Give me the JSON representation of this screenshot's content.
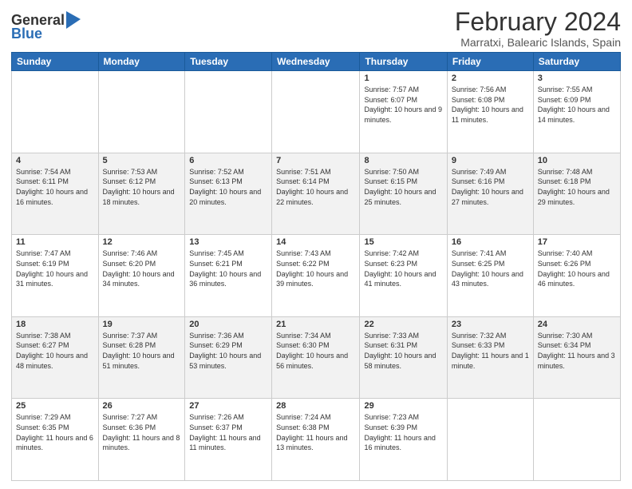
{
  "header": {
    "logo_general": "General",
    "logo_blue": "Blue",
    "title": "February 2024",
    "subtitle": "Marratxi, Balearic Islands, Spain"
  },
  "weekdays": [
    "Sunday",
    "Monday",
    "Tuesday",
    "Wednesday",
    "Thursday",
    "Friday",
    "Saturday"
  ],
  "weeks": [
    [
      {
        "day": "",
        "info": ""
      },
      {
        "day": "",
        "info": ""
      },
      {
        "day": "",
        "info": ""
      },
      {
        "day": "",
        "info": ""
      },
      {
        "day": "1",
        "info": "Sunrise: 7:57 AM\nSunset: 6:07 PM\nDaylight: 10 hours and 9 minutes."
      },
      {
        "day": "2",
        "info": "Sunrise: 7:56 AM\nSunset: 6:08 PM\nDaylight: 10 hours and 11 minutes."
      },
      {
        "day": "3",
        "info": "Sunrise: 7:55 AM\nSunset: 6:09 PM\nDaylight: 10 hours and 14 minutes."
      }
    ],
    [
      {
        "day": "4",
        "info": "Sunrise: 7:54 AM\nSunset: 6:11 PM\nDaylight: 10 hours and 16 minutes."
      },
      {
        "day": "5",
        "info": "Sunrise: 7:53 AM\nSunset: 6:12 PM\nDaylight: 10 hours and 18 minutes."
      },
      {
        "day": "6",
        "info": "Sunrise: 7:52 AM\nSunset: 6:13 PM\nDaylight: 10 hours and 20 minutes."
      },
      {
        "day": "7",
        "info": "Sunrise: 7:51 AM\nSunset: 6:14 PM\nDaylight: 10 hours and 22 minutes."
      },
      {
        "day": "8",
        "info": "Sunrise: 7:50 AM\nSunset: 6:15 PM\nDaylight: 10 hours and 25 minutes."
      },
      {
        "day": "9",
        "info": "Sunrise: 7:49 AM\nSunset: 6:16 PM\nDaylight: 10 hours and 27 minutes."
      },
      {
        "day": "10",
        "info": "Sunrise: 7:48 AM\nSunset: 6:18 PM\nDaylight: 10 hours and 29 minutes."
      }
    ],
    [
      {
        "day": "11",
        "info": "Sunrise: 7:47 AM\nSunset: 6:19 PM\nDaylight: 10 hours and 31 minutes."
      },
      {
        "day": "12",
        "info": "Sunrise: 7:46 AM\nSunset: 6:20 PM\nDaylight: 10 hours and 34 minutes."
      },
      {
        "day": "13",
        "info": "Sunrise: 7:45 AM\nSunset: 6:21 PM\nDaylight: 10 hours and 36 minutes."
      },
      {
        "day": "14",
        "info": "Sunrise: 7:43 AM\nSunset: 6:22 PM\nDaylight: 10 hours and 39 minutes."
      },
      {
        "day": "15",
        "info": "Sunrise: 7:42 AM\nSunset: 6:23 PM\nDaylight: 10 hours and 41 minutes."
      },
      {
        "day": "16",
        "info": "Sunrise: 7:41 AM\nSunset: 6:25 PM\nDaylight: 10 hours and 43 minutes."
      },
      {
        "day": "17",
        "info": "Sunrise: 7:40 AM\nSunset: 6:26 PM\nDaylight: 10 hours and 46 minutes."
      }
    ],
    [
      {
        "day": "18",
        "info": "Sunrise: 7:38 AM\nSunset: 6:27 PM\nDaylight: 10 hours and 48 minutes."
      },
      {
        "day": "19",
        "info": "Sunrise: 7:37 AM\nSunset: 6:28 PM\nDaylight: 10 hours and 51 minutes."
      },
      {
        "day": "20",
        "info": "Sunrise: 7:36 AM\nSunset: 6:29 PM\nDaylight: 10 hours and 53 minutes."
      },
      {
        "day": "21",
        "info": "Sunrise: 7:34 AM\nSunset: 6:30 PM\nDaylight: 10 hours and 56 minutes."
      },
      {
        "day": "22",
        "info": "Sunrise: 7:33 AM\nSunset: 6:31 PM\nDaylight: 10 hours and 58 minutes."
      },
      {
        "day": "23",
        "info": "Sunrise: 7:32 AM\nSunset: 6:33 PM\nDaylight: 11 hours and 1 minute."
      },
      {
        "day": "24",
        "info": "Sunrise: 7:30 AM\nSunset: 6:34 PM\nDaylight: 11 hours and 3 minutes."
      }
    ],
    [
      {
        "day": "25",
        "info": "Sunrise: 7:29 AM\nSunset: 6:35 PM\nDaylight: 11 hours and 6 minutes."
      },
      {
        "day": "26",
        "info": "Sunrise: 7:27 AM\nSunset: 6:36 PM\nDaylight: 11 hours and 8 minutes."
      },
      {
        "day": "27",
        "info": "Sunrise: 7:26 AM\nSunset: 6:37 PM\nDaylight: 11 hours and 11 minutes."
      },
      {
        "day": "28",
        "info": "Sunrise: 7:24 AM\nSunset: 6:38 PM\nDaylight: 11 hours and 13 minutes."
      },
      {
        "day": "29",
        "info": "Sunrise: 7:23 AM\nSunset: 6:39 PM\nDaylight: 11 hours and 16 minutes."
      },
      {
        "day": "",
        "info": ""
      },
      {
        "day": "",
        "info": ""
      }
    ]
  ]
}
